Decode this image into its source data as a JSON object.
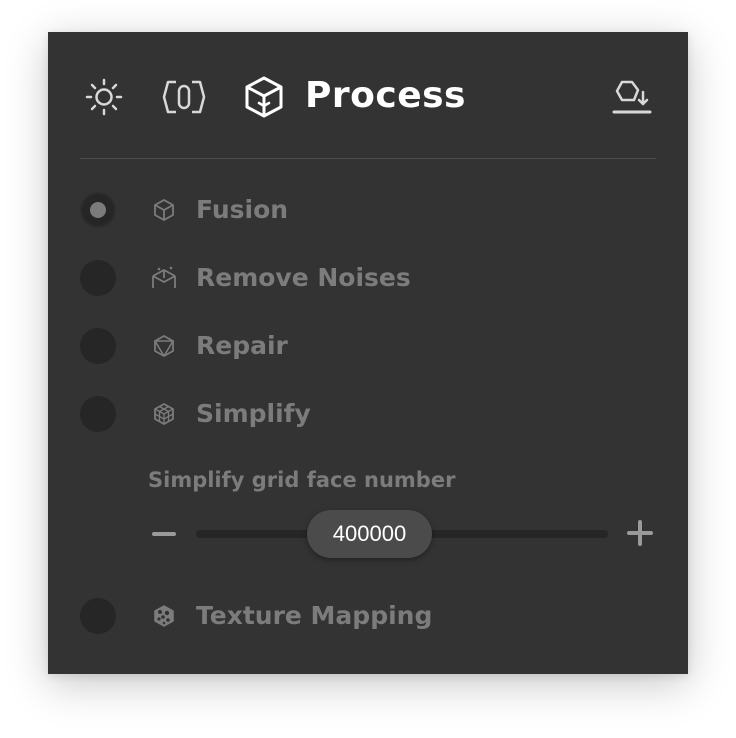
{
  "header": {
    "title": "Process",
    "icons": [
      "brightness-icon",
      "scan-mode-icon",
      "process-cube-icon",
      "export-model-icon"
    ]
  },
  "steps": [
    {
      "label": "Fusion",
      "icon": "fusion-cube-icon",
      "selected": true
    },
    {
      "label": "Remove Noises",
      "icon": "remove-noises-icon",
      "selected": false
    },
    {
      "label": "Repair",
      "icon": "repair-cube-icon",
      "selected": false
    },
    {
      "label": "Simplify",
      "icon": "simplify-mesh-icon",
      "selected": false
    },
    {
      "label": "Texture Mapping",
      "icon": "texture-mapping-icon",
      "selected": false
    }
  ],
  "simplify_param": {
    "label": "Simplify grid face number",
    "value": "400000",
    "slider_position_fraction": 0.41
  },
  "colors": {
    "panel_bg": "#333333",
    "title": "#ffffff",
    "label": "#7c7c7c",
    "radio_bg": "#262626"
  }
}
